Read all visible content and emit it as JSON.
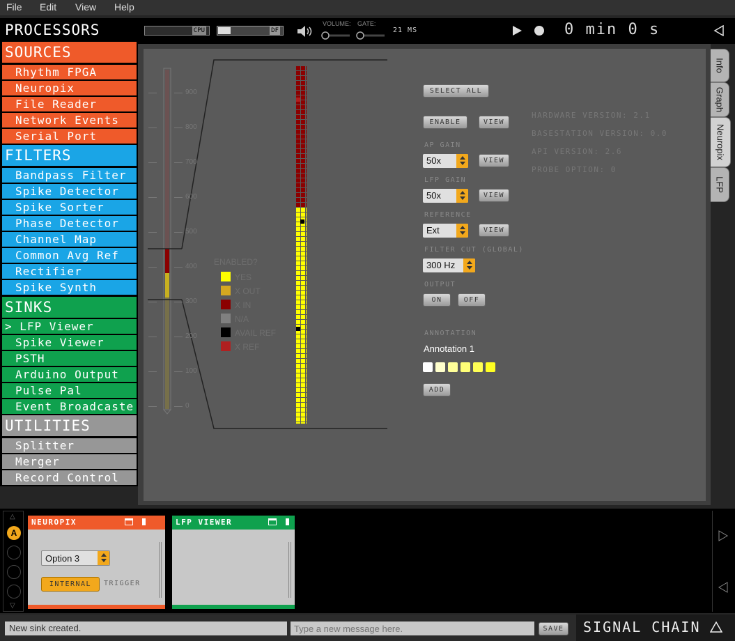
{
  "menu": [
    "File",
    "Edit",
    "View",
    "Help"
  ],
  "processors": {
    "title": "PROCESSORS",
    "sources": {
      "title": "SOURCES",
      "items": [
        "Rhythm FPGA",
        "Neuropix",
        "File Reader",
        "Network Events",
        "Serial Port"
      ]
    },
    "filters": {
      "title": "FILTERS",
      "items": [
        "Bandpass Filter",
        "Spike Detector",
        "Spike Sorter",
        "Phase Detector",
        "Channel Map",
        "Common Avg Ref",
        "Rectifier",
        "Spike Synth"
      ]
    },
    "sinks": {
      "title": "SINKS",
      "items": [
        "> LFP Viewer",
        "Spike Viewer",
        "PSTH",
        "Arduino Output",
        "Pulse Pal",
        "Event Broadcaste"
      ]
    },
    "utilities": {
      "title": "UTILITIES",
      "items": [
        "Splitter",
        "Merger",
        "Record Control"
      ]
    }
  },
  "control": {
    "cpu_label": "CPU",
    "df_label": "DF",
    "volume_label": "VOLUME:",
    "gate_label": "GATE:",
    "latency": "21 MS",
    "clock": "0 min 0 s"
  },
  "probe": {
    "ticks": [
      "900",
      "800",
      "700",
      "600",
      "500",
      "400",
      "300",
      "200",
      "100",
      "0"
    ]
  },
  "legend": {
    "title": "ENABLED?",
    "items": [
      {
        "label": "YES",
        "color": "#ffff00"
      },
      {
        "label": "X OUT",
        "color": "#d4a820"
      },
      {
        "label": "X IN",
        "color": "#8b0000"
      },
      {
        "label": "N/A",
        "color": "#808080"
      },
      {
        "label": "AVAIL REF",
        "color": "#000000"
      },
      {
        "label": "X REF",
        "color": "#b02020"
      }
    ]
  },
  "settings": {
    "select_all": "SELECT ALL",
    "enable": "ENABLE",
    "view": "VIEW",
    "ap_gain_label": "AP GAIN",
    "ap_gain_value": "50x",
    "lfp_gain_label": "LFP GAIN",
    "lfp_gain_value": "50x",
    "reference_label": "REFERENCE",
    "reference_value": "Ext",
    "filter_label": "FILTER CUT (GLOBAL)",
    "filter_value": "300 Hz",
    "output_label": "OUTPUT",
    "on": "ON",
    "off": "OFF",
    "annotation_label": "ANNOTATION",
    "annotation_text": "Annotation 1",
    "add": "ADD"
  },
  "info": {
    "hardware": "HARDWARE VERSION: 2.1",
    "basestation": "BASESTATION VERSION: 0.0",
    "api": "API VERSION: 2.6",
    "probe_option": "PROBE OPTION: 0"
  },
  "tabs": [
    "Info",
    "Graph",
    "Neuropix",
    "LFP"
  ],
  "chain": {
    "neuropix": {
      "title": "NEUROPIX",
      "option": "Option 3",
      "internal": "INTERNAL",
      "trigger": "TRIGGER"
    },
    "lfp": {
      "title": "LFP VIEWER"
    },
    "a_label": "A"
  },
  "status": {
    "message": "New sink created.",
    "input_placeholder": "Type a new message here.",
    "save": "SAVE",
    "signal_chain": "SIGNAL CHAIN"
  }
}
